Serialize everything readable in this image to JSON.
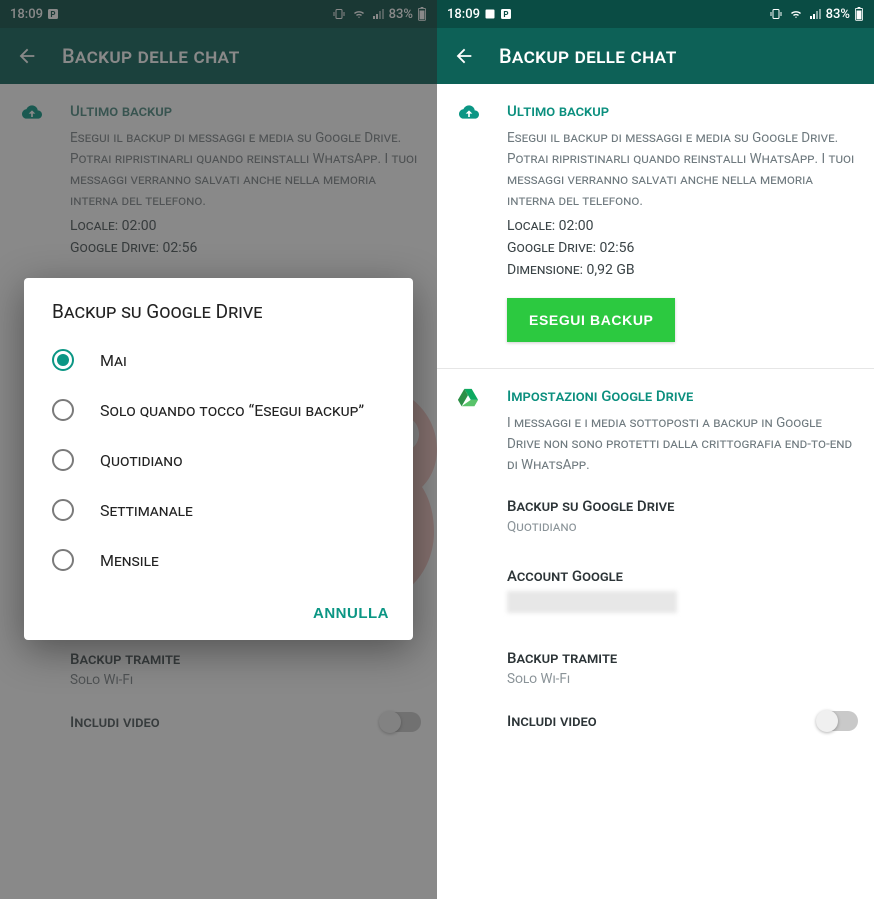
{
  "statusbar": {
    "time": "18:09",
    "battery": "83%"
  },
  "appbar": {
    "title": "Backup delle chat"
  },
  "backup": {
    "title": "Ultimo backup",
    "desc": "Esegui il backup di messaggi e media su Google Drive. Potrai ripristinarli quando reinstalli WhatsApp. I tuoi messaggi verranno salvati anche nella memoria interna del telefono.",
    "local": "Locale: 02:00",
    "gdrive": "Google Drive: 02:56",
    "size": "Dimensione: 0,92 GB",
    "button": "ESEGUI BACKUP"
  },
  "drive_settings": {
    "title": "Impostazioni Google Drive",
    "desc": "I messaggi e i media sottoposti a backup in Google Drive non sono protetti dalla crittografia end-to-end di WhatsApp."
  },
  "freq": {
    "label": "Backup su Google Drive",
    "value": "Quotidiano"
  },
  "account": {
    "label": "Account Google"
  },
  "via": {
    "label": "Backup tramite",
    "value": "Solo Wi-Fi"
  },
  "include_video": {
    "label": "Includi video"
  },
  "dialog": {
    "title": "Backup su Google Drive",
    "options": {
      "o0": "Mai",
      "o1": "Solo quando tocco “Esegui backup”",
      "o2": "Quotidiano",
      "o3": "Settimanale",
      "o4": "Mensile"
    },
    "cancel": "ANNULLA"
  }
}
